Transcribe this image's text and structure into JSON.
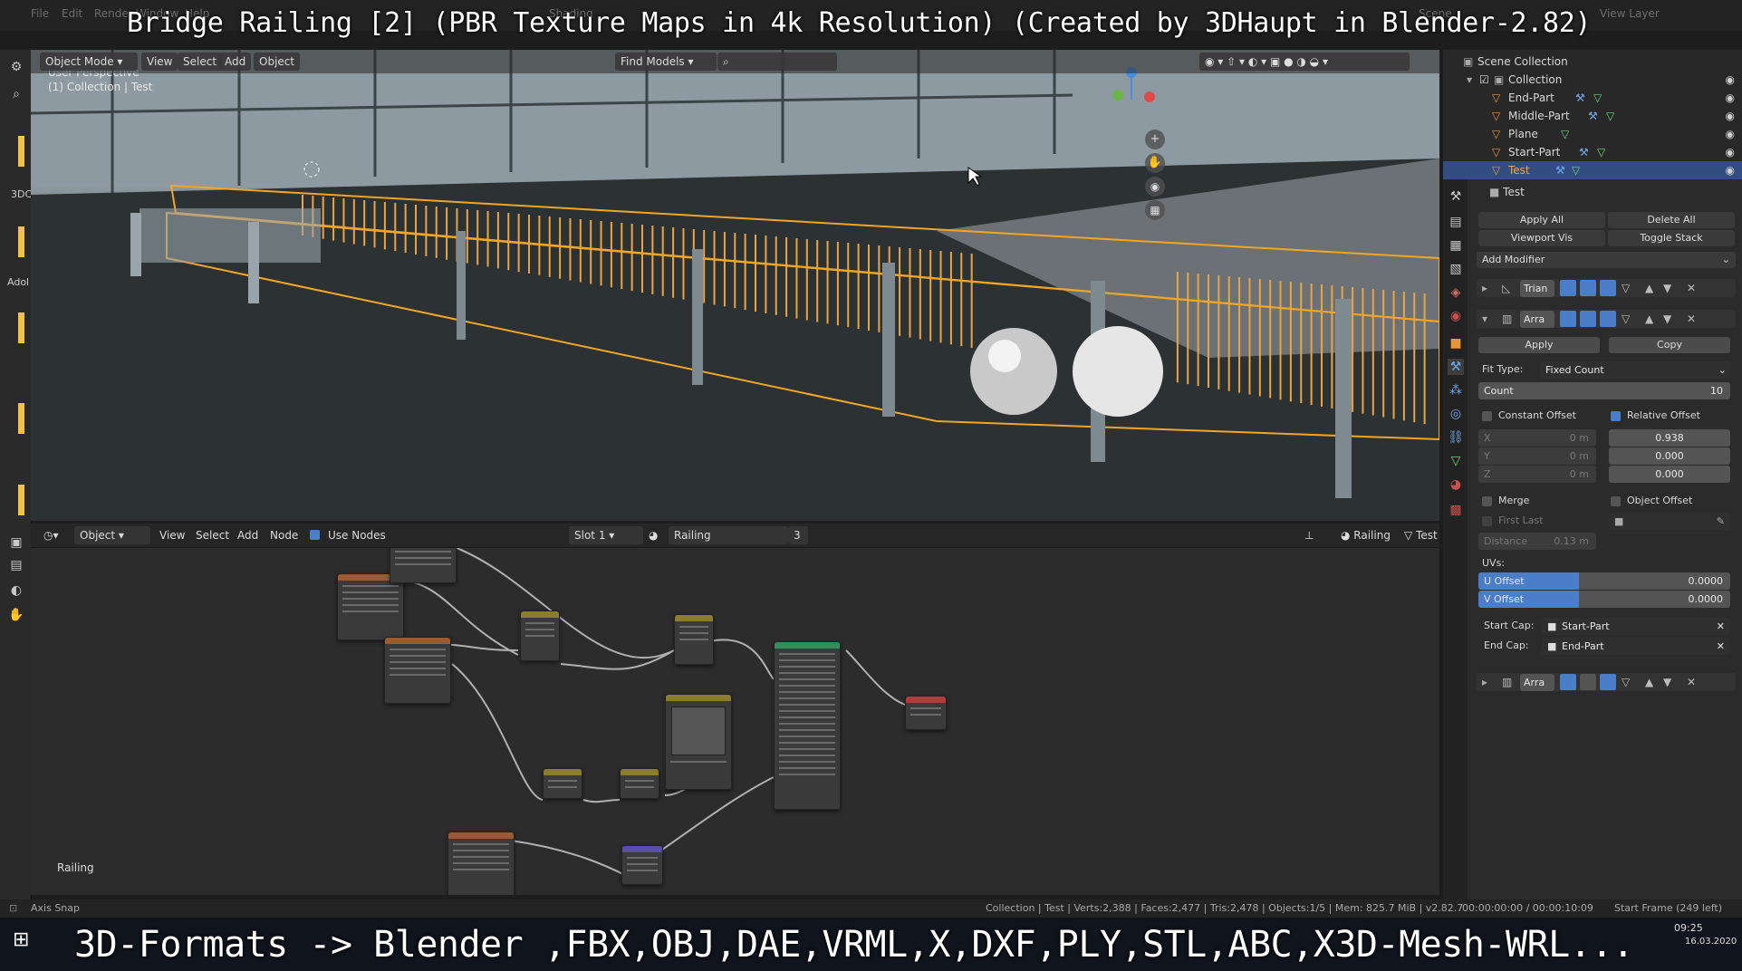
{
  "banner": {
    "title": "Bridge Railing [2] (PBR Texture Maps in 4k Resolution) (Created by 3DHaupt in Blender-2.82)",
    "bottom": "3D-Formats -> Blender ,FBX,OBJ,DAE,VRML,X,DXF,PLY,STL,ABC,X3D-Mesh-WRL..."
  },
  "topbar": {
    "menus": [
      "File",
      "Edit",
      "Render",
      "Window",
      "Help"
    ],
    "workspace": "Shading",
    "scene": "Scene",
    "view_layer": "View Layer"
  },
  "viewport": {
    "mode": "Object Mode",
    "menus": [
      "View",
      "Select",
      "Add",
      "Object"
    ],
    "find": "Find Models",
    "perspective": "User Perspective",
    "collection": "(1) Collection | Test",
    "side_labels": [
      "3DC",
      "Adol"
    ]
  },
  "node_editor": {
    "type": "Object",
    "menus": [
      "View",
      "Select",
      "Add",
      "Node"
    ],
    "use_nodes": "Use Nodes",
    "slot": "Slot 1",
    "material": "Railing",
    "users": "3",
    "material_right": "Railing",
    "object": "Test",
    "footer_label": "Railing"
  },
  "outliner": {
    "scene_collection": "Scene Collection",
    "collection": "Collection",
    "items": [
      "End-Part",
      "Middle-Part",
      "Plane",
      "Start-Part",
      "Test"
    ]
  },
  "properties": {
    "object_name": "Test",
    "apply_all": "Apply All",
    "delete_all": "Delete All",
    "viewport_vis": "Viewport Vis",
    "toggle_stack": "Toggle Stack",
    "add_modifier": "Add Modifier",
    "mod1_name": "Trian",
    "mod2_name": "Arra",
    "apply": "Apply",
    "copy": "Copy",
    "fit_type_label": "Fit Type:",
    "fit_type": "Fixed Count",
    "count_label": "Count",
    "count": "10",
    "constant_offset": "Constant Offset",
    "relative_offset": "Relative Offset",
    "axes": [
      "X",
      "Y",
      "Z"
    ],
    "const_vals": [
      "0 m",
      "0 m",
      "0 m"
    ],
    "rel_vals": [
      "0.938",
      "0.000",
      "0.000"
    ],
    "merge": "Merge",
    "object_offset": "Object Offset",
    "first_last": "First Last",
    "distance_label": "Distance",
    "distance": "0.13 m",
    "uvs": "UVs:",
    "u_offset_label": "U Offset",
    "u_offset": "0.0000",
    "v_offset_label": "V Offset",
    "v_offset": "0.0000",
    "start_cap_label": "Start Cap:",
    "start_cap": "Start-Part",
    "end_cap_label": "End Cap:",
    "end_cap": "End-Part",
    "mod3_name": "Arra"
  },
  "statusbar": {
    "left": "Axis Snap",
    "stats": "Collection | Test | Verts:2,388 | Faces:2,477 | Tris:2,478 | Objects:1/5 | Mem: 825.7 MiB | v2.82.7",
    "time": "00:00:00:00 / 00:00:10:09",
    "start_frame": "Start Frame (249 left)"
  },
  "taskbar": {
    "clock": "09:25",
    "date": "16.03.2020"
  },
  "colors": {
    "accent_blue": "#4a7ec8",
    "selection_orange": "#f5a623",
    "node_output_red": "#b23a3a",
    "node_shader_green": "#2f8f5a"
  }
}
